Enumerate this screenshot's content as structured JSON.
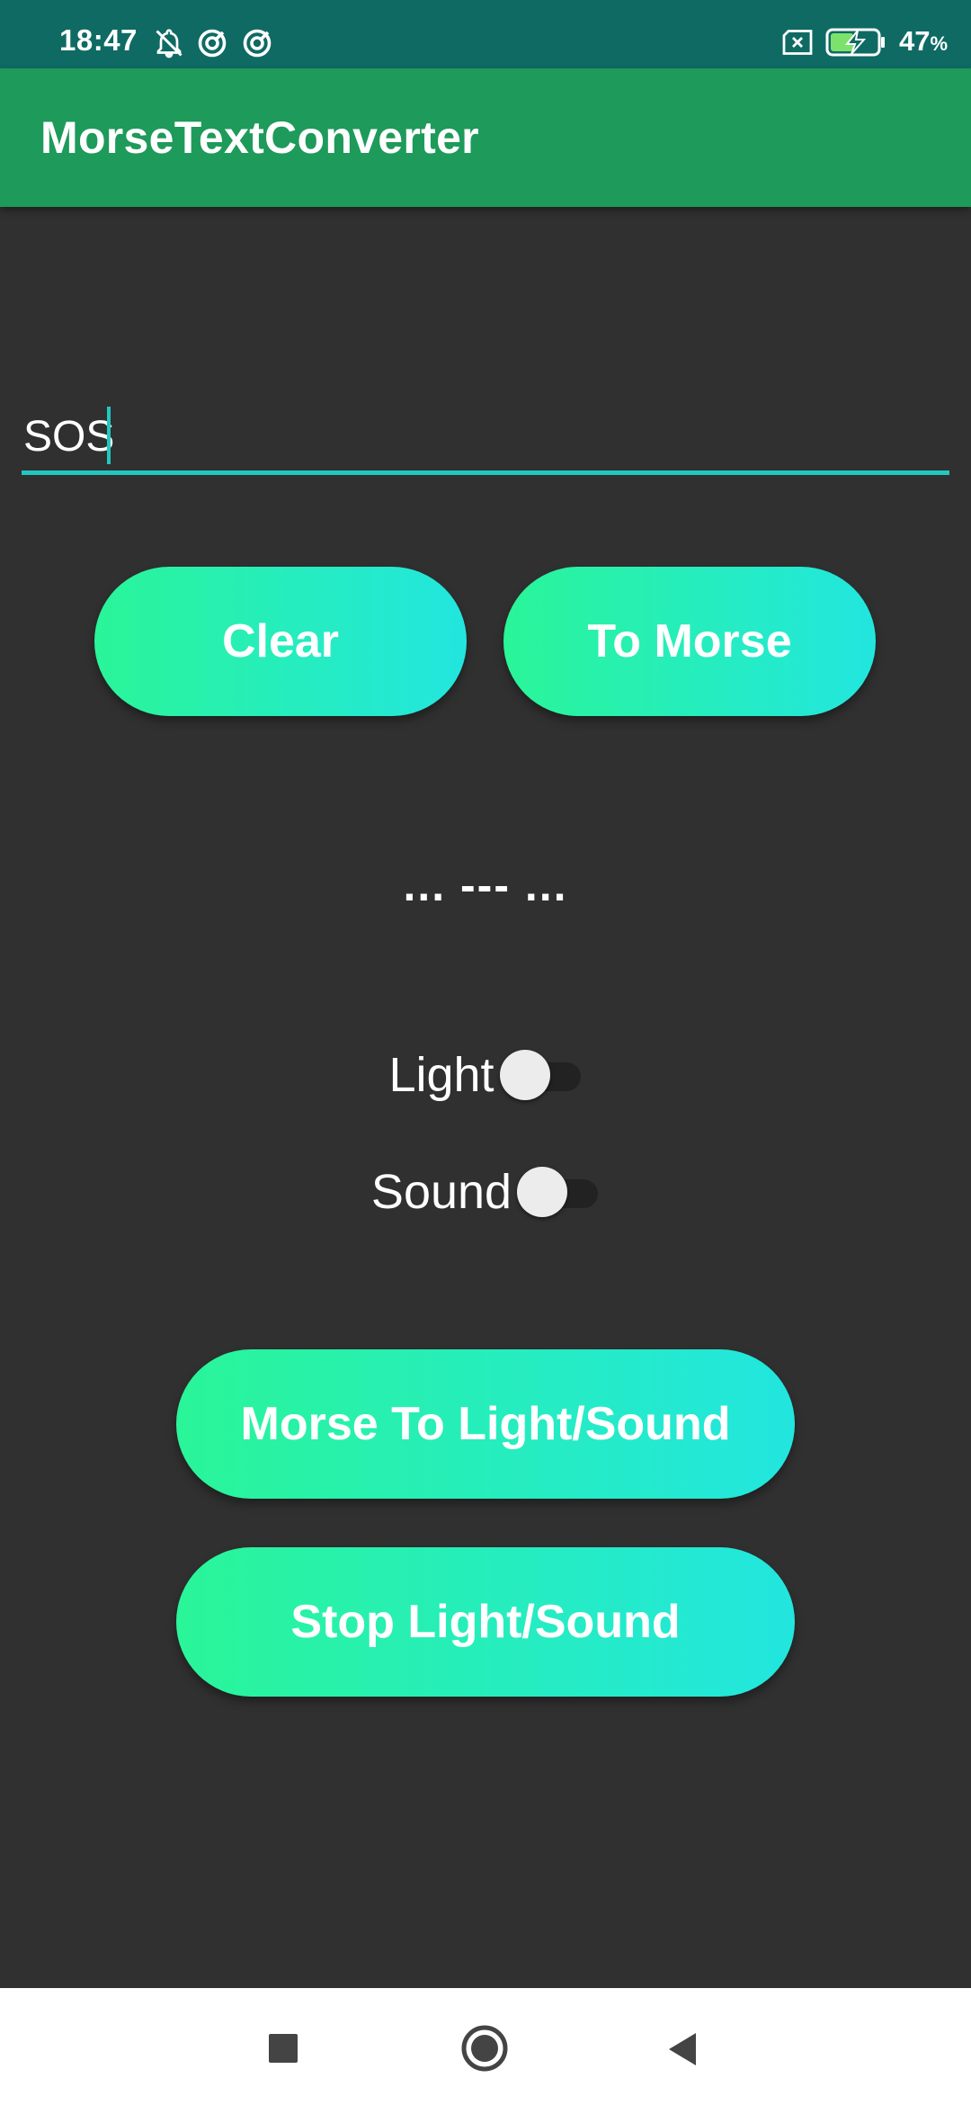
{
  "status_bar": {
    "time": "18:47",
    "battery_percent": "47",
    "battery_unit": "%",
    "icons": [
      "bell-off-icon",
      "sync-icon",
      "sync-icon",
      "no-sim-icon",
      "battery-charging-icon"
    ]
  },
  "app_bar": {
    "title": "MorseTextConverter"
  },
  "input": {
    "value": "SOS"
  },
  "buttons": {
    "clear": "Clear",
    "to_morse": "To Morse",
    "morse_to_light_sound": "Morse To Light/Sound",
    "stop_light_sound": "Stop Light/Sound"
  },
  "output": {
    "morse": "... --- ..."
  },
  "switches": {
    "light": {
      "label": "Light",
      "on": false
    },
    "sound": {
      "label": "Sound",
      "on": false
    }
  },
  "nav_bar": {
    "icons": [
      "recents-icon",
      "home-icon",
      "back-icon"
    ]
  },
  "colors": {
    "status_bar": "#0f6a64",
    "app_bar": "#1e9a5a",
    "background": "#303030",
    "accent": "#22c8c0",
    "gradient_start": "#2af598",
    "gradient_end": "#22e6df"
  }
}
